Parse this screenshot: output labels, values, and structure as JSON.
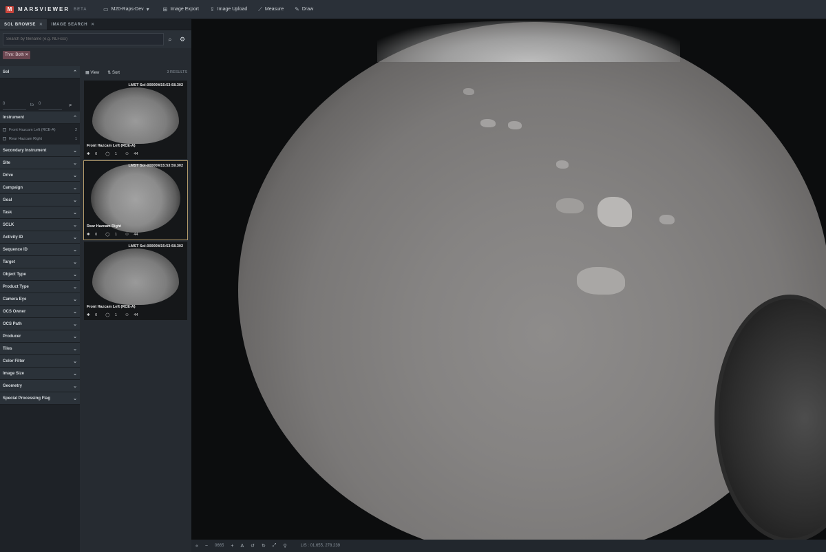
{
  "topbar": {
    "logo_text": "MARSVIEWER",
    "logo_sub": "BETA",
    "menus": [
      {
        "label": "M20-Raps-Dev",
        "icon": "folder-icon"
      },
      {
        "label": "Image Export",
        "icon": "export-icon"
      },
      {
        "label": "Image Upload",
        "icon": "upload-icon"
      },
      {
        "label": "Measure",
        "icon": "ruler-icon"
      },
      {
        "label": "Draw",
        "icon": "pen-icon"
      }
    ]
  },
  "tabs": [
    {
      "label": "SOL BROWSE",
      "active": true
    },
    {
      "label": "IMAGE SEARCH",
      "active": false
    }
  ],
  "search": {
    "placeholder": "Search by filename (e.g. NLFxxx)"
  },
  "chip": {
    "label": "Thm: Both"
  },
  "filters": {
    "sol_label": "Sol",
    "sol_from": "0",
    "sol_to_label": "to",
    "sol_to": "0",
    "instrument_label": "Instrument",
    "instruments": [
      {
        "label": "Front Hazcam Left (RCE-A)",
        "count": "2"
      },
      {
        "label": "Rear Hazcam Right",
        "count": "1"
      }
    ],
    "items": [
      "Secondary Instrument",
      "Site",
      "Drive",
      "Campaign",
      "Goal",
      "Task",
      "SCLK",
      "Activity ID",
      "Sequence ID",
      "Target",
      "Object Type",
      "Product Type",
      "Camera Eye",
      "OCS Owner",
      "OCS Path",
      "Producer",
      "Tiles",
      "Color Filter",
      "Image Size",
      "Geometry",
      "Special Processing Flag"
    ]
  },
  "results": {
    "view_label": "View",
    "sort_label": "Sort",
    "count": "3 RESULTS",
    "cards": [
      {
        "lmst": "LMST Sol-00000M15:53:58.302",
        "caption": "Front Hazcam Left (RCE-A)",
        "stars": "0",
        "comments": "1",
        "users": "44"
      },
      {
        "lmst": "LMST Sol-00000M15:53:59.302",
        "caption": "Rear Hazcam Right",
        "stars": "0",
        "comments": "1",
        "users": "44"
      },
      {
        "lmst": "LMST Sol-00000M15:53:58.302",
        "caption": "Front Hazcam Left (RCE-A)",
        "stars": "0",
        "comments": "1",
        "users": "44"
      }
    ]
  },
  "bottombar": {
    "zoom": "0665",
    "coords": "L/S : 01.655, 278.239"
  },
  "colors": {
    "accent": "#c8443b",
    "selection": "#b29a6a"
  }
}
